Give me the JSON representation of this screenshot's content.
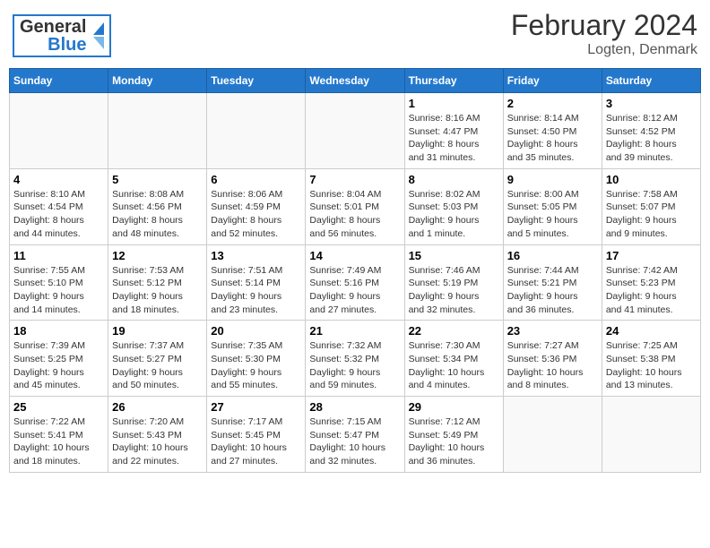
{
  "header": {
    "logo_general": "General",
    "logo_blue": "Blue",
    "title": "February 2024",
    "subtitle": "Logten, Denmark"
  },
  "weekdays": [
    "Sunday",
    "Monday",
    "Tuesday",
    "Wednesday",
    "Thursday",
    "Friday",
    "Saturday"
  ],
  "weeks": [
    {
      "days": [
        {
          "num": "",
          "info": ""
        },
        {
          "num": "",
          "info": ""
        },
        {
          "num": "",
          "info": ""
        },
        {
          "num": "",
          "info": ""
        },
        {
          "num": "1",
          "info": "Sunrise: 8:16 AM\nSunset: 4:47 PM\nDaylight: 8 hours\nand 31 minutes."
        },
        {
          "num": "2",
          "info": "Sunrise: 8:14 AM\nSunset: 4:50 PM\nDaylight: 8 hours\nand 35 minutes."
        },
        {
          "num": "3",
          "info": "Sunrise: 8:12 AM\nSunset: 4:52 PM\nDaylight: 8 hours\nand 39 minutes."
        }
      ]
    },
    {
      "days": [
        {
          "num": "4",
          "info": "Sunrise: 8:10 AM\nSunset: 4:54 PM\nDaylight: 8 hours\nand 44 minutes."
        },
        {
          "num": "5",
          "info": "Sunrise: 8:08 AM\nSunset: 4:56 PM\nDaylight: 8 hours\nand 48 minutes."
        },
        {
          "num": "6",
          "info": "Sunrise: 8:06 AM\nSunset: 4:59 PM\nDaylight: 8 hours\nand 52 minutes."
        },
        {
          "num": "7",
          "info": "Sunrise: 8:04 AM\nSunset: 5:01 PM\nDaylight: 8 hours\nand 56 minutes."
        },
        {
          "num": "8",
          "info": "Sunrise: 8:02 AM\nSunset: 5:03 PM\nDaylight: 9 hours\nand 1 minute."
        },
        {
          "num": "9",
          "info": "Sunrise: 8:00 AM\nSunset: 5:05 PM\nDaylight: 9 hours\nand 5 minutes."
        },
        {
          "num": "10",
          "info": "Sunrise: 7:58 AM\nSunset: 5:07 PM\nDaylight: 9 hours\nand 9 minutes."
        }
      ]
    },
    {
      "days": [
        {
          "num": "11",
          "info": "Sunrise: 7:55 AM\nSunset: 5:10 PM\nDaylight: 9 hours\nand 14 minutes."
        },
        {
          "num": "12",
          "info": "Sunrise: 7:53 AM\nSunset: 5:12 PM\nDaylight: 9 hours\nand 18 minutes."
        },
        {
          "num": "13",
          "info": "Sunrise: 7:51 AM\nSunset: 5:14 PM\nDaylight: 9 hours\nand 23 minutes."
        },
        {
          "num": "14",
          "info": "Sunrise: 7:49 AM\nSunset: 5:16 PM\nDaylight: 9 hours\nand 27 minutes."
        },
        {
          "num": "15",
          "info": "Sunrise: 7:46 AM\nSunset: 5:19 PM\nDaylight: 9 hours\nand 32 minutes."
        },
        {
          "num": "16",
          "info": "Sunrise: 7:44 AM\nSunset: 5:21 PM\nDaylight: 9 hours\nand 36 minutes."
        },
        {
          "num": "17",
          "info": "Sunrise: 7:42 AM\nSunset: 5:23 PM\nDaylight: 9 hours\nand 41 minutes."
        }
      ]
    },
    {
      "days": [
        {
          "num": "18",
          "info": "Sunrise: 7:39 AM\nSunset: 5:25 PM\nDaylight: 9 hours\nand 45 minutes."
        },
        {
          "num": "19",
          "info": "Sunrise: 7:37 AM\nSunset: 5:27 PM\nDaylight: 9 hours\nand 50 minutes."
        },
        {
          "num": "20",
          "info": "Sunrise: 7:35 AM\nSunset: 5:30 PM\nDaylight: 9 hours\nand 55 minutes."
        },
        {
          "num": "21",
          "info": "Sunrise: 7:32 AM\nSunset: 5:32 PM\nDaylight: 9 hours\nand 59 minutes."
        },
        {
          "num": "22",
          "info": "Sunrise: 7:30 AM\nSunset: 5:34 PM\nDaylight: 10 hours\nand 4 minutes."
        },
        {
          "num": "23",
          "info": "Sunrise: 7:27 AM\nSunset: 5:36 PM\nDaylight: 10 hours\nand 8 minutes."
        },
        {
          "num": "24",
          "info": "Sunrise: 7:25 AM\nSunset: 5:38 PM\nDaylight: 10 hours\nand 13 minutes."
        }
      ]
    },
    {
      "days": [
        {
          "num": "25",
          "info": "Sunrise: 7:22 AM\nSunset: 5:41 PM\nDaylight: 10 hours\nand 18 minutes."
        },
        {
          "num": "26",
          "info": "Sunrise: 7:20 AM\nSunset: 5:43 PM\nDaylight: 10 hours\nand 22 minutes."
        },
        {
          "num": "27",
          "info": "Sunrise: 7:17 AM\nSunset: 5:45 PM\nDaylight: 10 hours\nand 27 minutes."
        },
        {
          "num": "28",
          "info": "Sunrise: 7:15 AM\nSunset: 5:47 PM\nDaylight: 10 hours\nand 32 minutes."
        },
        {
          "num": "29",
          "info": "Sunrise: 7:12 AM\nSunset: 5:49 PM\nDaylight: 10 hours\nand 36 minutes."
        },
        {
          "num": "",
          "info": ""
        },
        {
          "num": "",
          "info": ""
        }
      ]
    }
  ]
}
